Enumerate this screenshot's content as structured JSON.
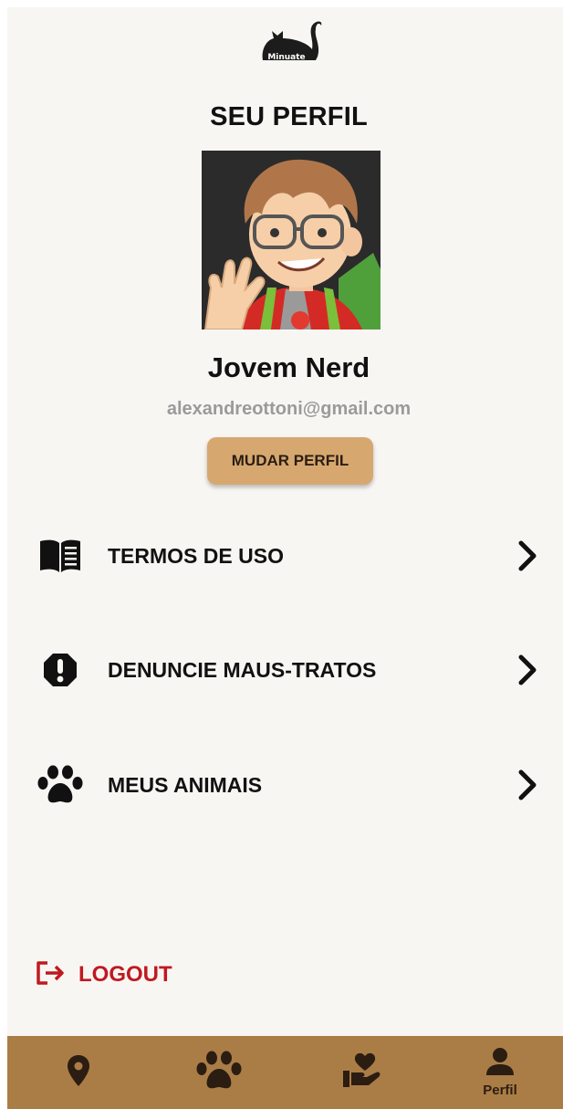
{
  "header": {
    "logo_text": "Minuate",
    "title": "SEU PERFIL"
  },
  "profile": {
    "name": "Jovem Nerd",
    "email": "alexandreottoni@gmail.com",
    "change_button": "MUDAR PERFIL"
  },
  "menu": [
    {
      "label": "TERMOS DE USO",
      "icon": "book-icon"
    },
    {
      "label": "DENUNCIE MAUS-TRATOS",
      "icon": "alert-icon"
    },
    {
      "label": "MEUS ANIMAIS",
      "icon": "paw-icon"
    }
  ],
  "logout": {
    "label": "LOGOUT",
    "color": "#c0191f"
  },
  "bottom_nav": {
    "background": "#ab7d46",
    "items": [
      {
        "icon": "location-pin-icon",
        "label": ""
      },
      {
        "icon": "paw-icon",
        "label": ""
      },
      {
        "icon": "donate-heart-icon",
        "label": ""
      },
      {
        "icon": "person-icon",
        "label": "Perfil",
        "active": true
      }
    ]
  },
  "colors": {
    "accent": "#d6a870",
    "background": "#f8f6f3",
    "nav": "#ab7d46"
  }
}
